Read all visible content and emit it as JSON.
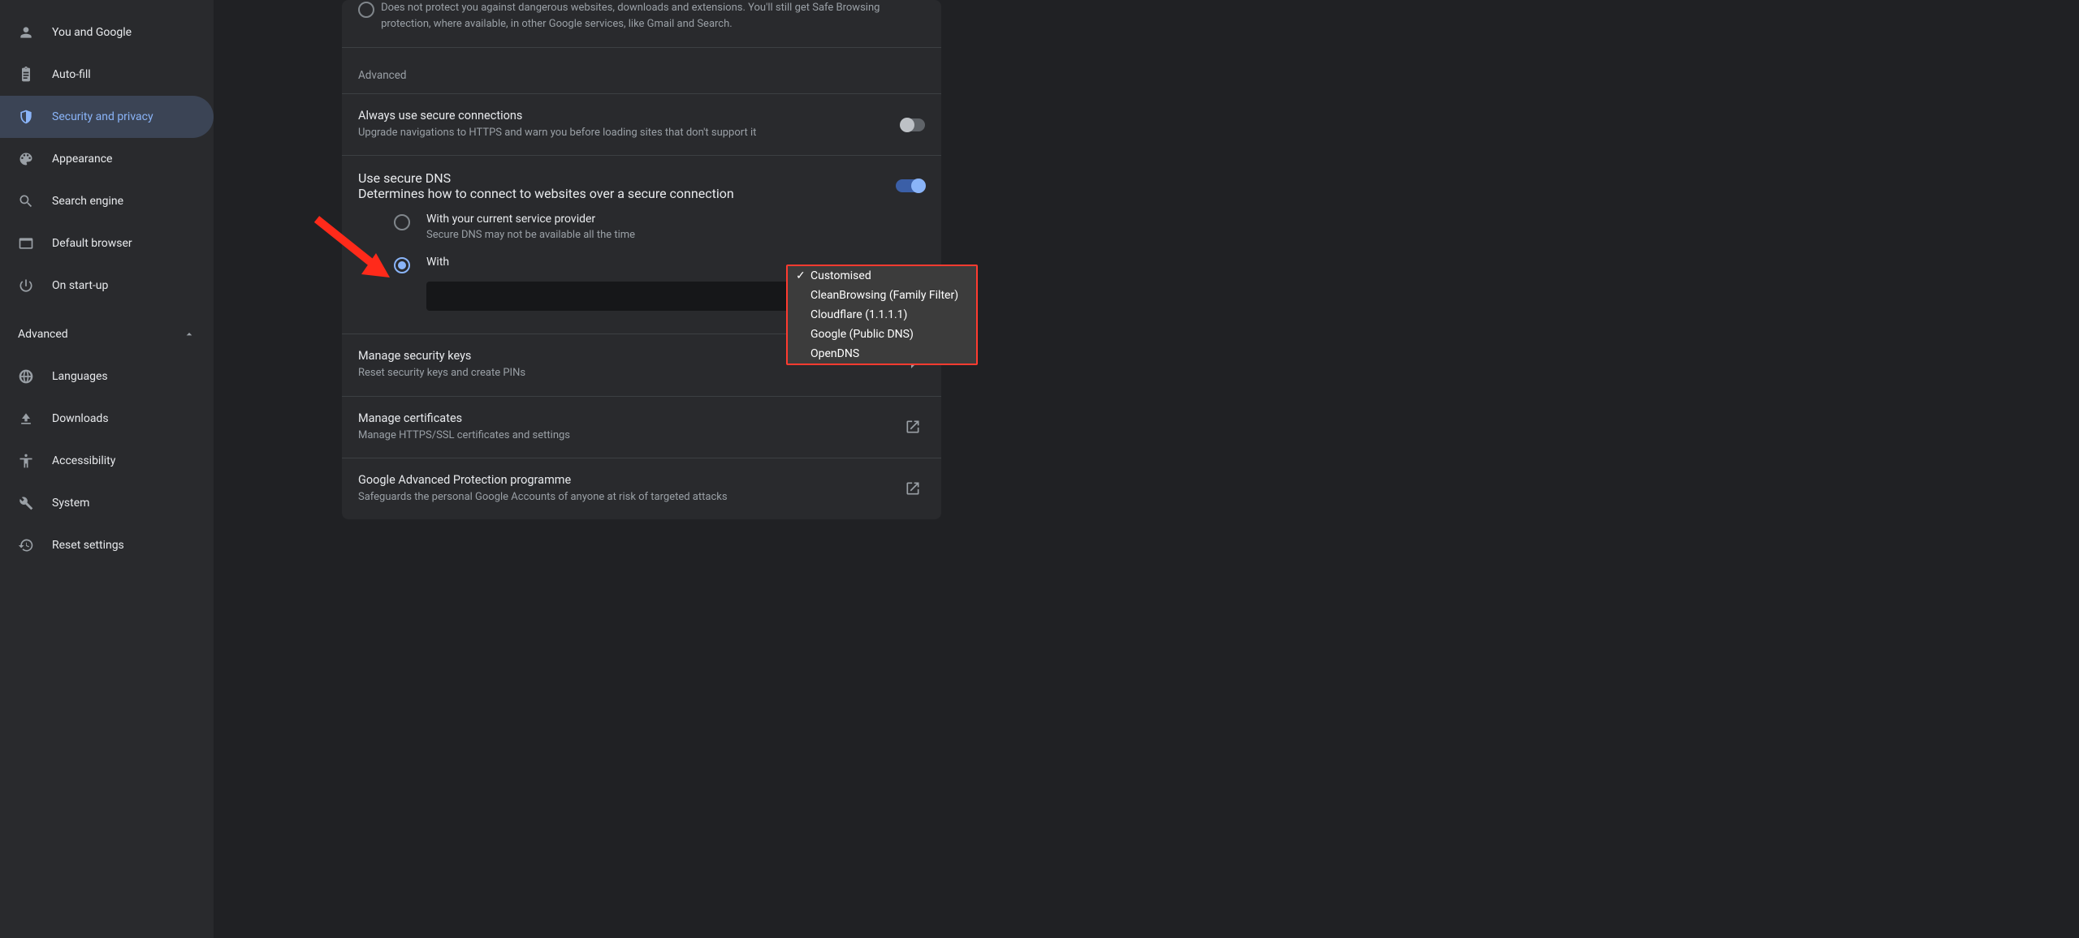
{
  "sidebar": {
    "items": [
      {
        "label": "You and Google"
      },
      {
        "label": "Auto-fill"
      },
      {
        "label": "Security and privacy"
      },
      {
        "label": "Appearance"
      },
      {
        "label": "Search engine"
      },
      {
        "label": "Default browser"
      },
      {
        "label": "On start-up"
      }
    ],
    "advanced_label": "Advanced",
    "adv_items": [
      {
        "label": "Languages"
      },
      {
        "label": "Downloads"
      },
      {
        "label": "Accessibility"
      },
      {
        "label": "System"
      },
      {
        "label": "Reset settings"
      }
    ]
  },
  "main": {
    "truncated_desc": "Does not protect you against dangerous websites, downloads and extensions. You'll still get Safe Browsing protection, where available, in other Google services, like Gmail and Search.",
    "advanced_header": "Advanced",
    "secure_conn": {
      "title": "Always use secure connections",
      "sub": "Upgrade navigations to HTTPS and warn you before loading sites that don't support it"
    },
    "secure_dns": {
      "title": "Use secure DNS",
      "sub": "Determines how to connect to websites over a secure connection",
      "opt1_title": "With your current service provider",
      "opt1_sub": "Secure DNS may not be available all the time",
      "opt2_title": "With"
    },
    "dropdown": {
      "items": [
        "Customised",
        "CleanBrowsing (Family Filter)",
        "Cloudflare (1.1.1.1)",
        "Google (Public DNS)",
        "OpenDNS"
      ]
    },
    "sec_keys": {
      "title": "Manage security keys",
      "sub": "Reset security keys and create PINs"
    },
    "certs": {
      "title": "Manage certificates",
      "sub": "Manage HTTPS/SSL certificates and settings"
    },
    "gapp": {
      "title": "Google Advanced Protection programme",
      "sub": "Safeguards the personal Google Accounts of anyone at risk of targeted attacks"
    }
  }
}
